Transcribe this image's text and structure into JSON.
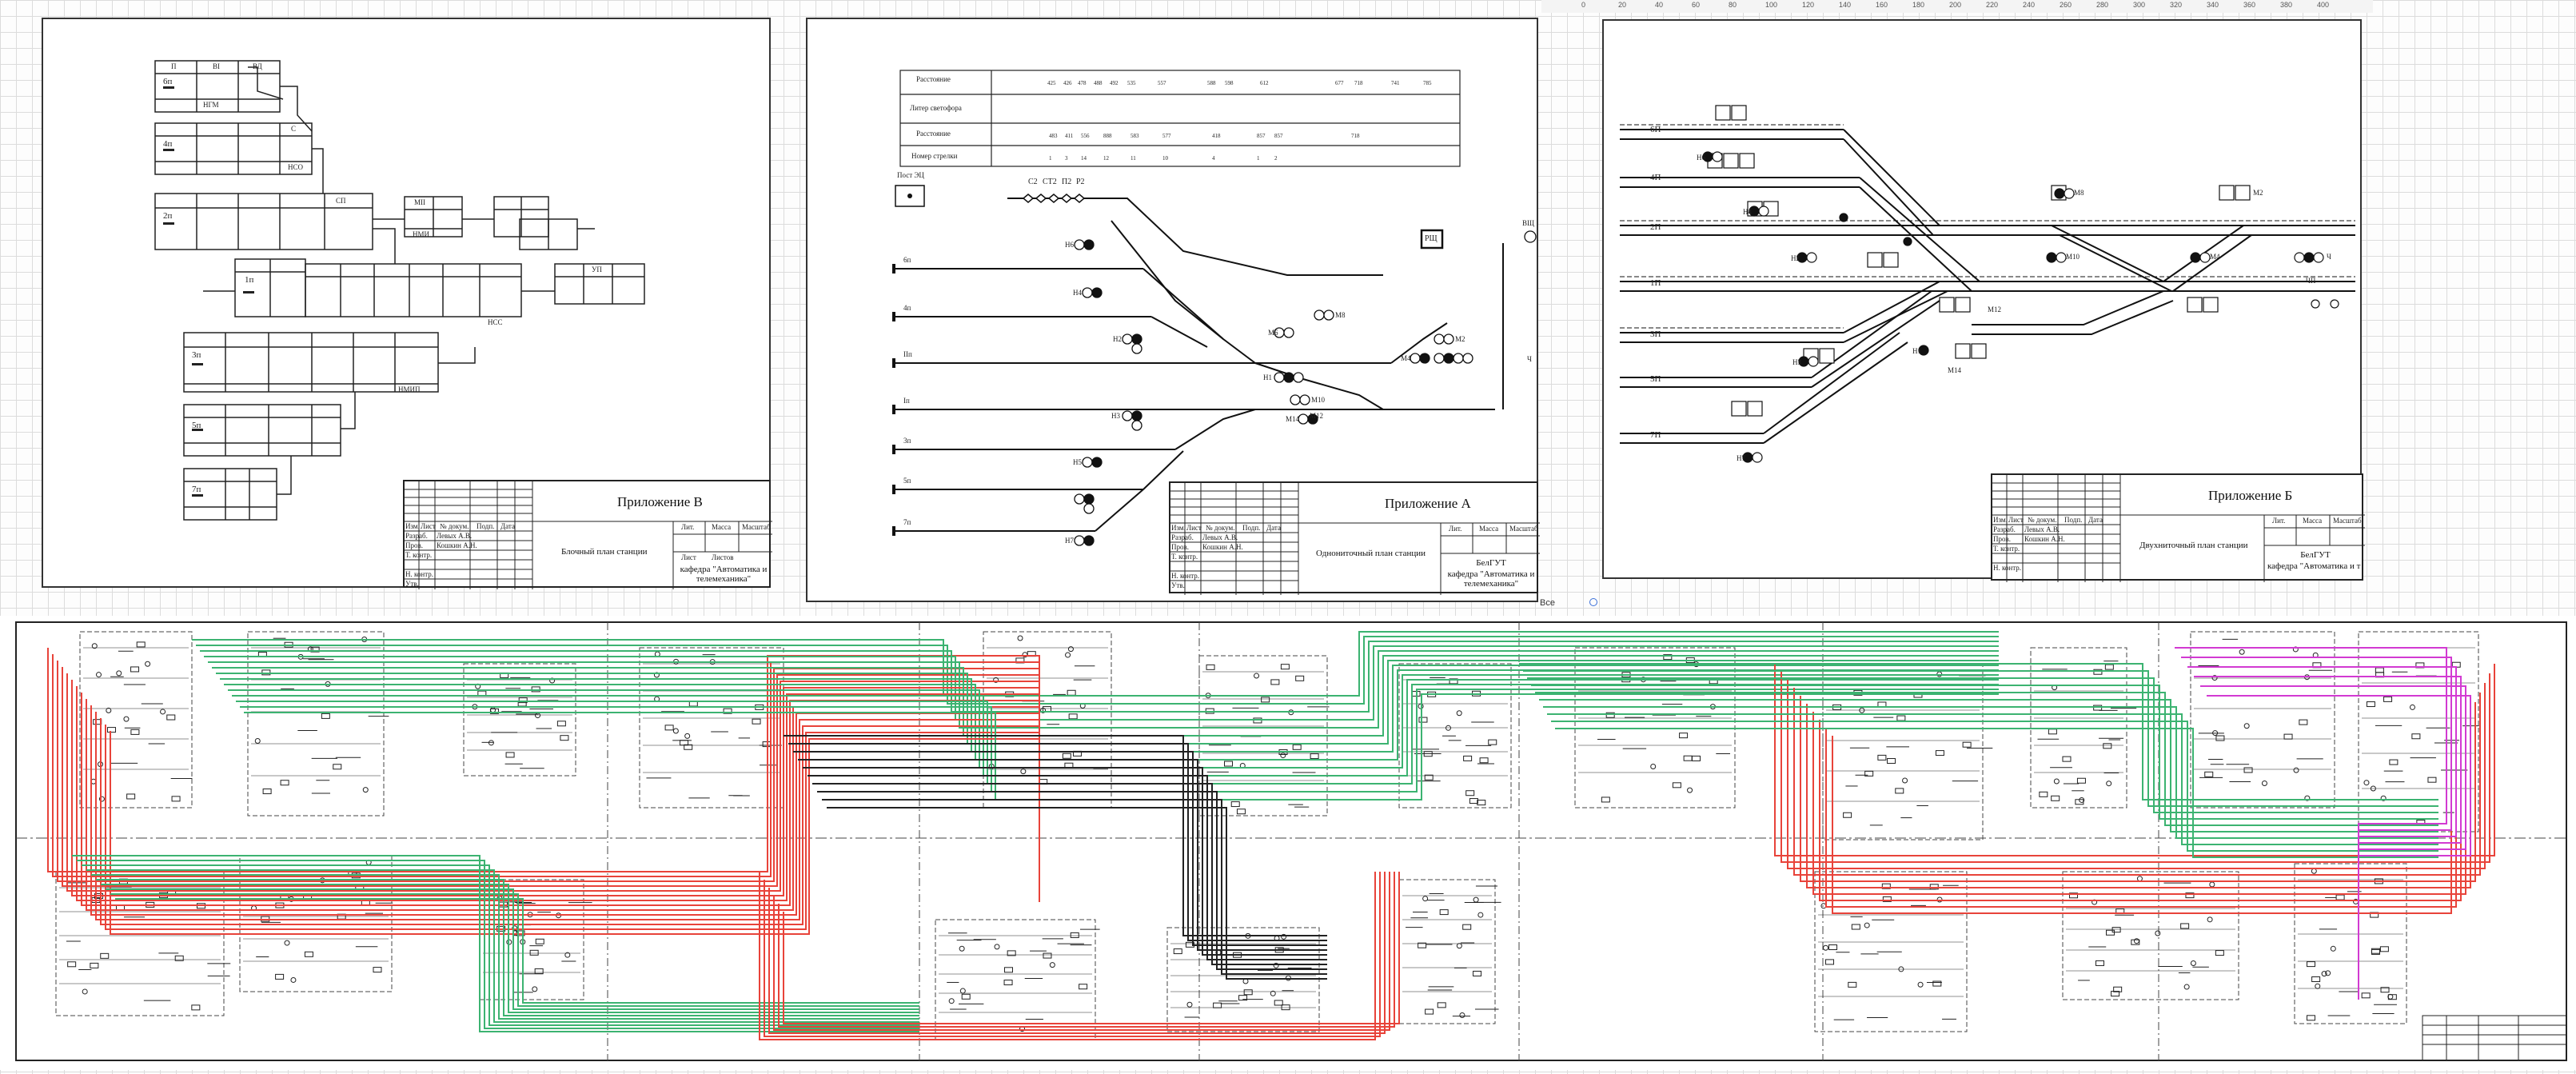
{
  "sheets": {
    "b": {
      "appendix": "Приложение В",
      "caption": "Блочный план станции",
      "dept": "кафедра \"Автоматика и телемеханика\"",
      "tb_head": [
        "Изм.",
        "Лист",
        "№ докум.",
        "Подп.",
        "Дата"
      ],
      "tb_roles": [
        "Разраб.",
        "Пров.",
        "Т. контр.",
        "Н. контр.",
        "Утв."
      ],
      "tb_names": [
        "Левых А.В.",
        "Кошкин А.Н."
      ],
      "tb_right": [
        "Лит.",
        "Масса",
        "Масштаб"
      ],
      "tb_sheet": [
        "Лист",
        "Листов"
      ],
      "tracks": [
        "6п",
        "4п",
        "2п",
        "1п",
        "3п",
        "5п",
        "7п"
      ],
      "blocks": [
        "П",
        "ВI",
        "ВД",
        "С",
        "СП",
        "МII",
        "УП",
        "НГМ",
        "НСО",
        "НМИ",
        "НМИП",
        "НСС"
      ]
    },
    "a": {
      "appendix": "Приложение А",
      "caption": "Однониточный план станции",
      "org": "БелГУТ",
      "dept": "кафедра \"Автоматика и телемеханика\"",
      "tb_head": [
        "Изм.",
        "Лист",
        "№ докум.",
        "Подп.",
        "Дата"
      ],
      "tb_roles": [
        "Разраб.",
        "Пров.",
        "Т. контр.",
        "Н. контр.",
        "Утв."
      ],
      "tb_names": [
        "Левых А.В.",
        "Кошкин А.Н."
      ],
      "tb_right": [
        "Лит.",
        "Масса",
        "Масштаб"
      ],
      "table_rows": [
        "Расстояние",
        "Литер светофора",
        "Расстояние",
        "Номер стрелки"
      ],
      "post": "Пост ЭЦ",
      "signals_top": [
        "С2",
        "СТ2",
        "П2",
        "Р2"
      ],
      "tracks": [
        "6п",
        "4п",
        "IIп",
        "Iп",
        "3п",
        "5п",
        "7п"
      ],
      "signals": [
        "Н6",
        "Н4",
        "Н2",
        "Н1",
        "Н3",
        "Н5",
        "Н7",
        "М8",
        "М6",
        "М4",
        "М2",
        "М10",
        "М12",
        "М14",
        "Ч"
      ],
      "device": "РЩ",
      "device2": "ВЩ"
    },
    "c": {
      "appendix": "Приложение Б",
      "caption": "Двухниточный план станции",
      "org": "БелГУТ",
      "dept": "кафедра \"Автоматика и т",
      "tb_head": [
        "Изм.",
        "Лист",
        "№ докум.",
        "Подп.",
        "Дата"
      ],
      "tb_roles": [
        "Разраб.",
        "Пров.",
        "Т. контр.",
        "Н. контр."
      ],
      "tb_names": [
        "Левых А.В.",
        "Кошкин А.Н."
      ],
      "tb_right": [
        "Лит.",
        "Масса",
        "Масштаб"
      ],
      "tracks": [
        "6П",
        "4П",
        "2П",
        "1П",
        "3П",
        "5П",
        "7П"
      ],
      "signals": [
        "Н6",
        "Н4",
        "Н2",
        "Н1",
        "Н3",
        "Н5",
        "Н7",
        "М2",
        "М4",
        "М6",
        "М8",
        "М10",
        "М12",
        "М14",
        "Ч",
        "ЧП"
      ]
    }
  },
  "ruler": {
    "ticks": [
      "0",
      "20",
      "40",
      "60",
      "80",
      "100",
      "120",
      "140",
      "160",
      "180",
      "200",
      "220",
      "240",
      "260",
      "280",
      "300",
      "320",
      "340",
      "360",
      "380",
      "400"
    ]
  },
  "toolbar": {
    "zoom_label": "Все"
  },
  "colors": {
    "red": "#e8433a",
    "green": "#3cb371",
    "magenta": "#d23ad2",
    "black": "#222222"
  }
}
